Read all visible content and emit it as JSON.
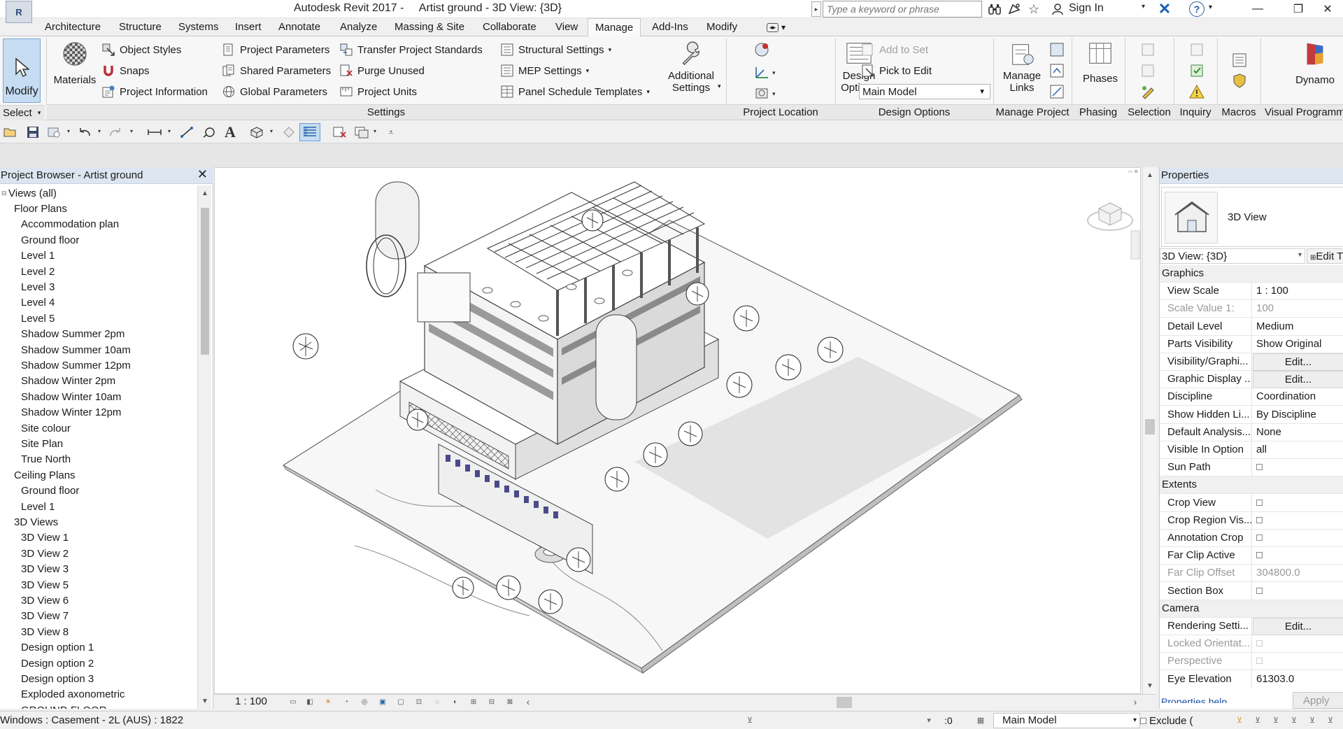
{
  "title_bar": {
    "title": "Autodesk Revit 2017 -     Artist ground - 3D View: {3D}",
    "search_placeholder": "Type a keyword or phrase",
    "signin": "Sign In"
  },
  "ribbon_tabs": [
    "Architecture",
    "Structure",
    "Systems",
    "Insert",
    "Annotate",
    "Analyze",
    "Massing & Site",
    "Collaborate",
    "View",
    "Manage",
    "Add-Ins",
    "Modify"
  ],
  "active_tab": "Manage",
  "ribbon": {
    "modify": "Modify",
    "select": "Select",
    "materials": "Materials",
    "settings_col1": [
      "Object  Styles",
      "Snaps",
      "Project  Information"
    ],
    "settings_col2": [
      "Project  Parameters",
      "Shared  Parameters",
      "Global  Parameters"
    ],
    "settings_col3": [
      "Transfer  Project Standards",
      "Purge  Unused",
      "Project  Units"
    ],
    "settings_col4": [
      "Structural  Settings",
      "MEP   Settings",
      "Panel Schedule  Templates"
    ],
    "additional_settings": "Additional\nSettings",
    "design_options": "Design\nOptions",
    "add_to_set": "Add to Set",
    "pick_to_edit": "Pick to Edit",
    "main_model": "Main Model",
    "manage_links": "Manage\nLinks",
    "phases": "Phases",
    "dynamo": "Dynamo",
    "panels": {
      "settings": "Settings",
      "project_location": "Project Location",
      "design_options": "Design Options",
      "manage_project": "Manage Project",
      "phasing": "Phasing",
      "selection": "Selection",
      "inquiry": "Inquiry",
      "macros": "Macros",
      "visual_programming": "Visual Programm"
    }
  },
  "project_browser": {
    "title": "Project Browser - Artist ground",
    "tree": [
      {
        "label": "Views (all)",
        "level": 0
      },
      {
        "label": "Floor Plans",
        "level": 1
      },
      {
        "label": "Accommodation plan",
        "level": 2
      },
      {
        "label": "Ground floor",
        "level": 2
      },
      {
        "label": "Level 1",
        "level": 2
      },
      {
        "label": "Level 2",
        "level": 2
      },
      {
        "label": "Level 3",
        "level": 2
      },
      {
        "label": "Level 4",
        "level": 2
      },
      {
        "label": "Level 5",
        "level": 2
      },
      {
        "label": "Shadow Summer 2pm",
        "level": 2
      },
      {
        "label": "Shadow Summer 10am",
        "level": 2
      },
      {
        "label": "Shadow Summer 12pm",
        "level": 2
      },
      {
        "label": "Shadow Winter 2pm",
        "level": 2
      },
      {
        "label": "Shadow Winter 10am",
        "level": 2
      },
      {
        "label": "Shadow Winter 12pm",
        "level": 2
      },
      {
        "label": "Site colour",
        "level": 2
      },
      {
        "label": "Site Plan",
        "level": 2
      },
      {
        "label": "True North",
        "level": 2
      },
      {
        "label": "Ceiling Plans",
        "level": 1
      },
      {
        "label": "Ground floor",
        "level": 2
      },
      {
        "label": "Level 1",
        "level": 2
      },
      {
        "label": "3D Views",
        "level": 1
      },
      {
        "label": "3D View 1",
        "level": 2
      },
      {
        "label": "3D View 2",
        "level": 2
      },
      {
        "label": "3D View 3",
        "level": 2
      },
      {
        "label": "3D View 5",
        "level": 2
      },
      {
        "label": "3D View 6",
        "level": 2
      },
      {
        "label": "3D View 7",
        "level": 2
      },
      {
        "label": "3D View 8",
        "level": 2
      },
      {
        "label": "Design option 1",
        "level": 2
      },
      {
        "label": "Design option 2",
        "level": 2
      },
      {
        "label": "Design option 3",
        "level": 2
      },
      {
        "label": "Exploded axonometric",
        "level": 2
      },
      {
        "label": "GROUND FLOOR",
        "level": 2
      }
    ]
  },
  "view": {
    "scale": "1 : 100"
  },
  "properties": {
    "title": "Properties",
    "type_name": "3D View",
    "view_selector": "3D View: {3D}",
    "edit_type": "Edit T",
    "rows": [
      {
        "kind": "cat",
        "name": "Graphics"
      },
      {
        "kind": "val",
        "name": "View Scale",
        "value": "1 : 100"
      },
      {
        "kind": "val",
        "name": "Scale Value    1:",
        "value": "100",
        "dim": true
      },
      {
        "kind": "val",
        "name": "Detail Level",
        "value": "Medium"
      },
      {
        "kind": "val",
        "name": "Parts Visibility",
        "value": "Show Original"
      },
      {
        "kind": "btn",
        "name": "Visibility/Graphi...",
        "value": "Edit..."
      },
      {
        "kind": "btn",
        "name": "Graphic Display ...",
        "value": "Edit..."
      },
      {
        "kind": "val",
        "name": "Discipline",
        "value": "Coordination"
      },
      {
        "kind": "val",
        "name": "Show Hidden Li...",
        "value": "By Discipline"
      },
      {
        "kind": "val",
        "name": "Default Analysis...",
        "value": "None"
      },
      {
        "kind": "val",
        "name": "Visible In Option",
        "value": "all"
      },
      {
        "kind": "chk",
        "name": "Sun Path"
      },
      {
        "kind": "cat",
        "name": "Extents"
      },
      {
        "kind": "chk",
        "name": "Crop View"
      },
      {
        "kind": "chk",
        "name": "Crop Region Vis..."
      },
      {
        "kind": "chk",
        "name": "Annotation Crop"
      },
      {
        "kind": "chk",
        "name": "Far Clip Active"
      },
      {
        "kind": "val",
        "name": "Far Clip Offset",
        "value": "304800.0",
        "dim": true
      },
      {
        "kind": "chk",
        "name": "Section Box"
      },
      {
        "kind": "cat",
        "name": "Camera"
      },
      {
        "kind": "btn",
        "name": "Rendering Setti...",
        "value": "Edit..."
      },
      {
        "kind": "chk",
        "name": "Locked Orientat...",
        "dim": true
      },
      {
        "kind": "chk",
        "name": "Perspective",
        "dim": true
      },
      {
        "kind": "val",
        "name": "Eye Elevation",
        "value": "61303.0"
      }
    ],
    "help_link": "Properties help",
    "apply": "Apply"
  },
  "status_bar": {
    "selection": "Windows : Casement - 2L (AUS) : 1822",
    "zero": ":0",
    "model": "Main Model",
    "exclude": "Exclude ("
  }
}
